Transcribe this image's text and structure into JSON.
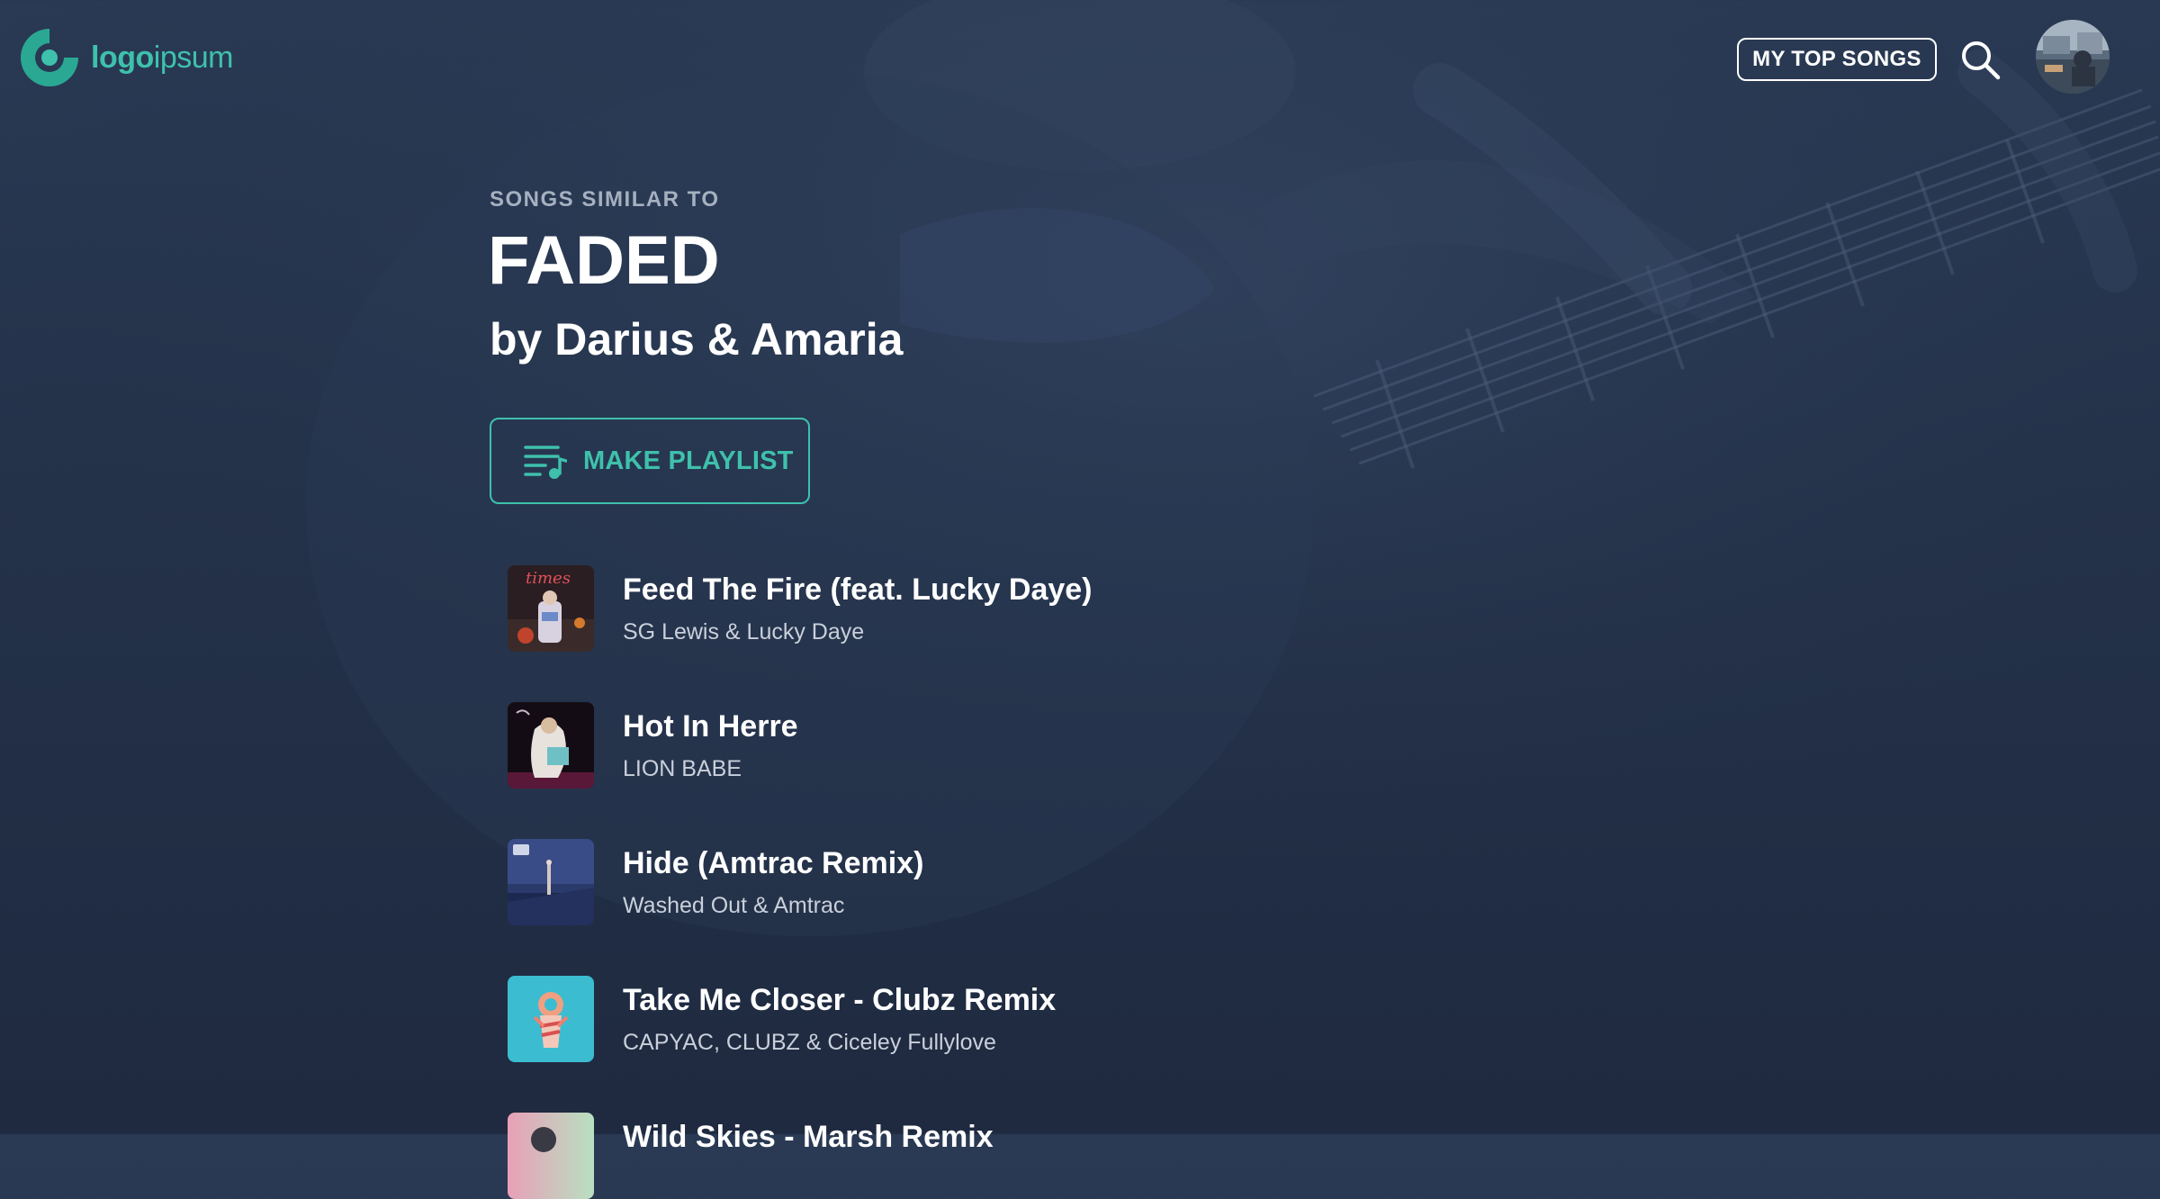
{
  "header": {
    "logo_text_bold": "logo",
    "logo_text_light": "ipsum",
    "top_songs_label": "MY TOP SONGS",
    "search_icon": "search-icon",
    "avatar_icon": "user-avatar"
  },
  "hero": {
    "eyebrow": "SONGS SIMILAR TO",
    "title": "FADED",
    "artist": "by Darius & Amaria",
    "playlist_button_label": "MAKE PLAYLIST",
    "playlist_icon": "playlist-music-icon"
  },
  "songs": [
    {
      "title": "Feed The Fire (feat. Lucky Daye)",
      "artist": "SG Lewis & Lucky Daye",
      "cover_text": "times"
    },
    {
      "title": "Hot In Herre",
      "artist": "LION BABE"
    },
    {
      "title": "Hide (Amtrac Remix)",
      "artist": "Washed Out & Amtrac"
    },
    {
      "title": "Take Me Closer - Clubz Remix",
      "artist": "CAPYAC, CLUBZ & Ciceley Fullylove"
    },
    {
      "title": "Wild Skies - Marsh Remix",
      "artist": ""
    }
  ],
  "colors": {
    "accent": "#3ec1ac",
    "background": "#24324a",
    "text_muted": "#a6b0c0"
  }
}
